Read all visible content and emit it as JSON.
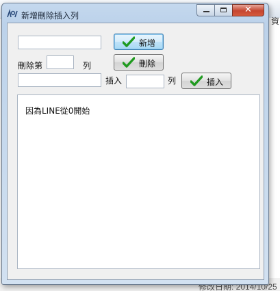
{
  "window": {
    "title": "新增刪除插入列",
    "close_glyph": "✕"
  },
  "background": {
    "right_panel_text": "資",
    "status_text": "修改日期: 2014/10/25"
  },
  "row1": {
    "input_value": "",
    "add_button_label": "新增"
  },
  "row2": {
    "prefix_label": "刪除第",
    "input_value": "",
    "suffix_label": "列",
    "delete_button_label": "刪除"
  },
  "row3": {
    "input_value": "",
    "insert_label": "插入",
    "row_input_value": "",
    "suffix_label": "列",
    "insert_button_label": "插入"
  },
  "memo": {
    "text": "因為LINE從0開始"
  },
  "colors": {
    "check_green": "#1f9a1f",
    "close_red": "#c5452f"
  },
  "icons": {
    "app": "app-icon",
    "check": "checkmark-icon"
  }
}
